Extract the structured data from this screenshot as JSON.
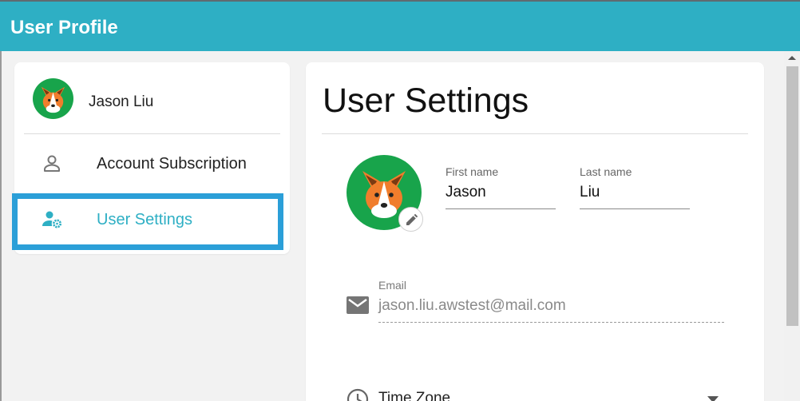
{
  "app": {
    "title": "User Profile"
  },
  "sidebar": {
    "user_name": "Jason Liu",
    "items": [
      {
        "label": "Account Subscription",
        "icon": "person-outline-icon",
        "active": false
      },
      {
        "label": "User Settings",
        "icon": "user-settings-icon",
        "active": true
      }
    ]
  },
  "main": {
    "title": "User Settings",
    "first_name": {
      "label": "First name",
      "value": "Jason"
    },
    "last_name": {
      "label": "Last name",
      "value": "Liu"
    },
    "email": {
      "label": "Email",
      "value": "jason.liu.awstest@mail.com"
    },
    "time_zone": {
      "label": "Time Zone"
    }
  },
  "colors": {
    "accent": "#2eafc4",
    "highlight_border": "#2b9fd8",
    "avatar_bg": "#18a44b",
    "dog_orange": "#f07d2c"
  }
}
